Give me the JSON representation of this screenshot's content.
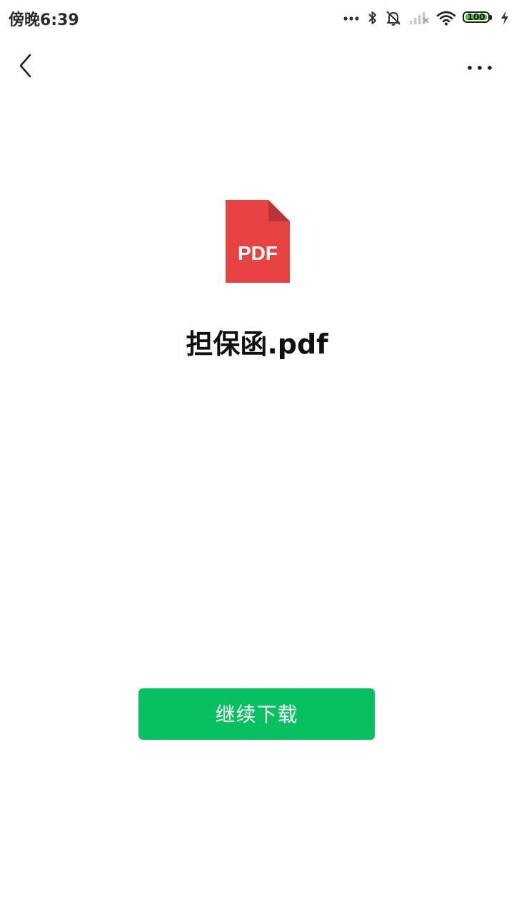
{
  "status_bar": {
    "time": "傍晚6:39",
    "battery_level": "100",
    "battery_fraction": 1.0,
    "icons": [
      "more-dots-icon",
      "bluetooth-icon",
      "mute-bell-icon",
      "signal-no-service-icon",
      "wifi-icon",
      "battery-icon",
      "charging-bolt-icon"
    ],
    "battery_color": "#49c429"
  },
  "nav": {
    "back_icon": "chevron-left-icon",
    "more_icon": "more-horizontal-icon"
  },
  "file": {
    "type_label": "PDF",
    "name": "担保函.pdf",
    "icon_color": "#e84343",
    "icon_fold_color": "#b93535"
  },
  "actions": {
    "download_label": "继续下载",
    "download_color": "#07c160"
  }
}
